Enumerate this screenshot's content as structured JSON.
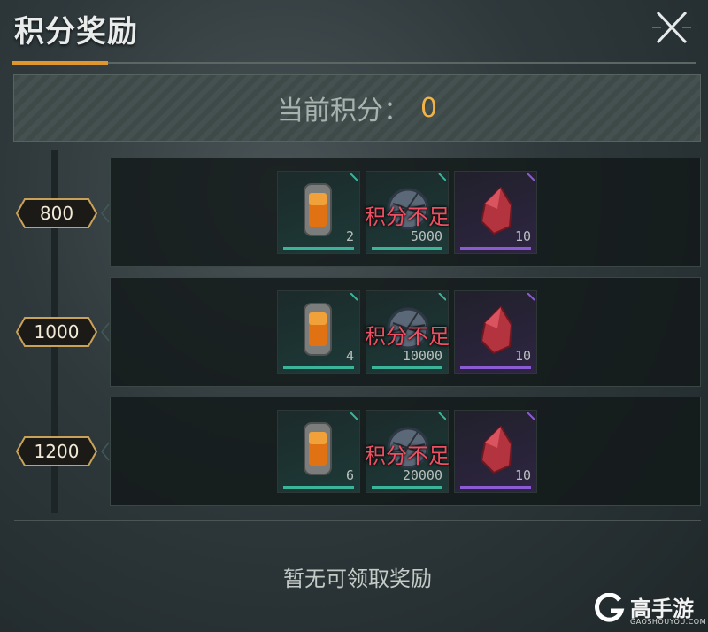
{
  "header": {
    "title": "积分奖励",
    "close_icon": "close-x-icon"
  },
  "points": {
    "label": "当前积分：",
    "value": "0"
  },
  "tiers": [
    {
      "threshold": "800",
      "status": "积分不足",
      "items": [
        {
          "icon": "energy-canister-icon",
          "qty": "2",
          "rarity": "green"
        },
        {
          "icon": "metal-orb-icon",
          "qty": "5000",
          "rarity": "green"
        },
        {
          "icon": "red-crystal-icon",
          "qty": "10",
          "rarity": "purple"
        }
      ]
    },
    {
      "threshold": "1000",
      "status": "积分不足",
      "items": [
        {
          "icon": "energy-canister-icon",
          "qty": "4",
          "rarity": "green"
        },
        {
          "icon": "metal-orb-icon",
          "qty": "10000",
          "rarity": "green"
        },
        {
          "icon": "red-crystal-icon",
          "qty": "10",
          "rarity": "purple"
        }
      ]
    },
    {
      "threshold": "1200",
      "status": "积分不足",
      "items": [
        {
          "icon": "energy-canister-icon",
          "qty": "6",
          "rarity": "green"
        },
        {
          "icon": "metal-orb-icon",
          "qty": "20000",
          "rarity": "green"
        },
        {
          "icon": "red-crystal-icon",
          "qty": "10",
          "rarity": "purple"
        }
      ]
    }
  ],
  "footer": {
    "message": "暂无可领取奖励"
  },
  "watermark": {
    "brand": "高手游",
    "domain": "GAOSHOUYOU.COM"
  },
  "colors": {
    "accent": "#e0962e",
    "points_value": "#f1b347",
    "insufficient": "#ef4f62",
    "rarity_green": "#3bb59a",
    "rarity_purple": "#8a5bd3"
  }
}
